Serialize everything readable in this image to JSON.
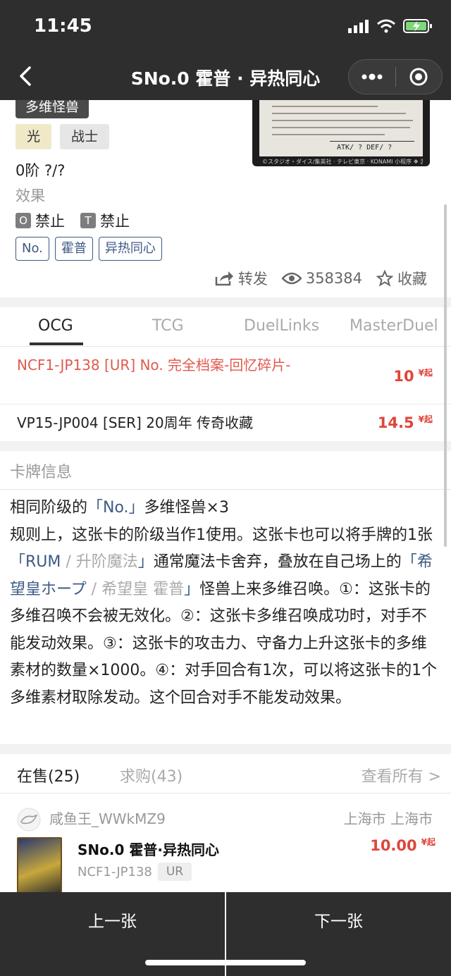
{
  "status": {
    "time": "11:45"
  },
  "nav": {
    "title": "SNo.0 霍普 · 异热同心"
  },
  "card": {
    "type_tag": "多维怪兽",
    "attribute": "光",
    "race": "战士",
    "rank": "0阶 ?/?",
    "effect_type": "效果",
    "ban": [
      {
        "badge": "O",
        "label": "禁止"
      },
      {
        "badge": "T",
        "label": "禁止"
      }
    ],
    "tags": [
      "No.",
      "霍普",
      "异热同心"
    ],
    "art": {
      "atk_def": "ATK/  ? DEF/  ?",
      "footer": "©スタジオ・ダイス/集英社 · テレビ東京 · KONAMI  小程序 ❖ 游戏王查卡器"
    }
  },
  "actions": {
    "share": "转发",
    "views": "358384",
    "favorite": "收藏"
  },
  "tabs": [
    "OCG",
    "TCG",
    "DuelLinks",
    "MasterDuel"
  ],
  "prices": [
    {
      "name": "NCF1-JP138 [UR] No. 完全档案-回忆碎片-",
      "price": "10",
      "unit": "¥起"
    },
    {
      "name": "VP15-JP004 [SER] 20周年 传奇收藏",
      "price": "14.5",
      "unit": "¥起"
    }
  ],
  "card_info": {
    "title": "卡牌信息",
    "l1_a": "相同阶级的",
    "kw_no": "「No.」",
    "l1_b": "多维怪兽×3",
    "l2_a": "规则上，这张卡的阶级当作1使用。这张卡也可以将手牌的1张",
    "kw_rum_open": "「RUM",
    "dim_rum": " / 升阶魔法",
    "kw_rum_close": "」",
    "l2_b": "通常魔法卡舍弃，叠放在自己场上的",
    "kw_hope_open": "「希望皇ホープ",
    "dim_hope": " / 希望皇 霍普",
    "kw_hope_close": "」",
    "l2_c": "怪兽上来多维召唤。①：这张卡的多维召唤不会被无效化。②：这张卡多维召唤成功时，对手不能发动效果。③：这张卡的攻击力、守备力上升这张卡的多维素材的数量×1000。④：对手回合有1次，可以将这张卡的1个多维素材取除发动。这个回合对手不能发动效果。"
  },
  "sale_tabs": {
    "on_sale": "在售(25)",
    "wanted": "求购(43)",
    "view_all": "查看所有 >"
  },
  "listing": {
    "seller": "咸鱼王_WWkMZ9",
    "location": "上海市 上海市",
    "title": "SNo.0 霍普·异热同心",
    "code": "NCF1-JP138",
    "rarity": "UR",
    "price": "10.00",
    "unit": "¥起"
  },
  "bottom": {
    "prev": "上一张",
    "next": "下一张"
  }
}
